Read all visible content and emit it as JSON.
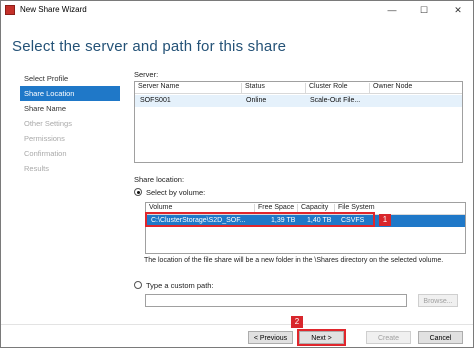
{
  "window": {
    "title": "New Share Wizard",
    "controls": [
      "—",
      "☐",
      "✕"
    ]
  },
  "header": {
    "page_title": "Select the server and path for this share"
  },
  "steps": [
    {
      "label": "Select Profile",
      "state": "normal"
    },
    {
      "label": "Share Location",
      "state": "active"
    },
    {
      "label": "Share Name",
      "state": "normal"
    },
    {
      "label": "Other Settings",
      "state": "disabled"
    },
    {
      "label": "Permissions",
      "state": "disabled"
    },
    {
      "label": "Confirmation",
      "state": "disabled"
    },
    {
      "label": "Results",
      "state": "disabled"
    }
  ],
  "server_section": {
    "label": "Server:",
    "columns": [
      "Server Name",
      "Status",
      "Cluster Role",
      "Owner Node"
    ],
    "rows": [
      {
        "server_name": "SOFS001",
        "status": "Online",
        "cluster_role": "Scale-Out File...",
        "owner_node": ""
      }
    ]
  },
  "share_location": {
    "label": "Share location:",
    "select_by_volume_label": "Select by volume:",
    "columns": [
      "Volume",
      "Free Space",
      "Capacity",
      "File System"
    ],
    "rows": [
      {
        "volume": "C:\\ClusterStorage\\S2D_SOF...",
        "free_space": "1,39 TB",
        "capacity": "1,40 TB",
        "file_system": "CSVFS"
      }
    ],
    "note": "The location of the file share will be a new folder in the \\Shares directory on the selected volume.",
    "custom_path_label": "Type a custom path:",
    "custom_path_value": "",
    "browse_label": "Browse..."
  },
  "buttons": {
    "previous": "< Previous",
    "next": "Next >",
    "create": "Create",
    "cancel": "Cancel"
  },
  "annotations": {
    "badge1": "1",
    "badge2": "2"
  },
  "colors": {
    "accent": "#1f78c8",
    "title": "#245277",
    "annotation": "#e0262c"
  }
}
